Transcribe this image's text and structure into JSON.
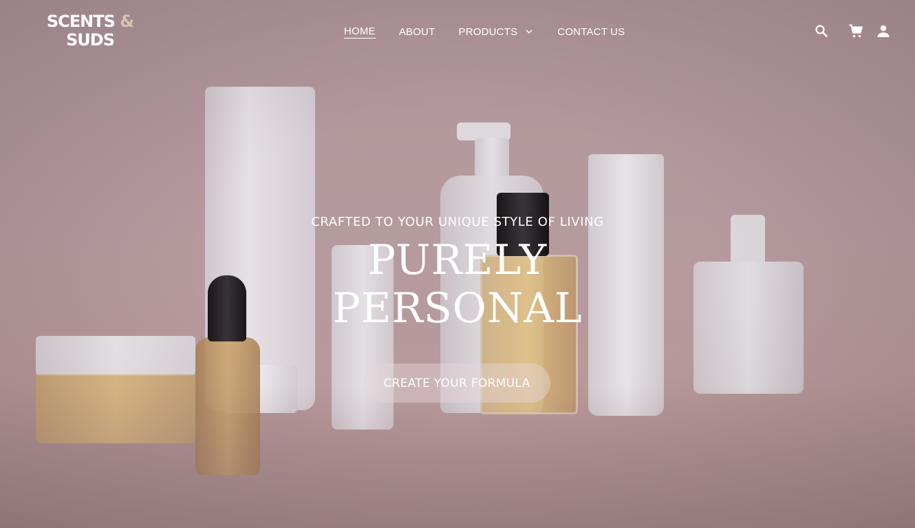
{
  "brand": {
    "logo_line1": "SCENTS ",
    "logo_amp": "&",
    "logo_line2": "SUDS"
  },
  "nav": {
    "items": [
      {
        "label": "HOME",
        "active": true
      },
      {
        "label": "ABOUT"
      },
      {
        "label": "PRODUCTS",
        "has_dropdown": true
      },
      {
        "label": "CONTACT US"
      }
    ]
  },
  "header_icons": [
    "search-icon",
    "cart-icon",
    "account-icon"
  ],
  "hero": {
    "tagline": "CRAFTED TO YOUR UNIQUE STYLE OF LIVING",
    "headline_line1": "PURELY",
    "headline_line2": "PERSONAL",
    "cta_label": "CREATE YOUR FORMULA"
  },
  "colors": {
    "accent": "#d9c3b5",
    "text": "#ffffff",
    "background": "#b59a9e"
  }
}
